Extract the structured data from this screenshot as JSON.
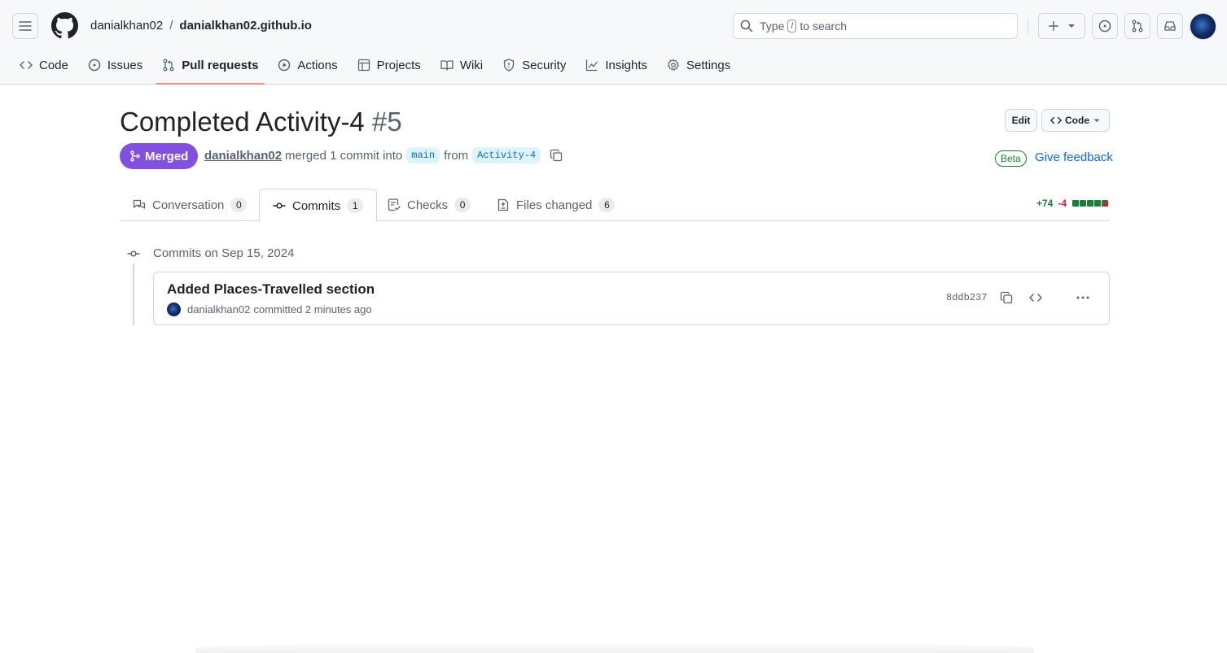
{
  "header": {
    "owner": "danialkhan02",
    "separator": "/",
    "repo": "danialkhan02.github.io",
    "search": {
      "prefix": "Type",
      "key": "/",
      "suffix": "to search"
    }
  },
  "nav": {
    "items": [
      {
        "label": "Code",
        "icon": "code-icon"
      },
      {
        "label": "Issues",
        "icon": "issue-icon"
      },
      {
        "label": "Pull requests",
        "icon": "pull-request-icon",
        "selected": true
      },
      {
        "label": "Actions",
        "icon": "play-icon"
      },
      {
        "label": "Projects",
        "icon": "table-icon"
      },
      {
        "label": "Wiki",
        "icon": "book-icon"
      },
      {
        "label": "Security",
        "icon": "shield-icon"
      },
      {
        "label": "Insights",
        "icon": "graph-icon"
      },
      {
        "label": "Settings",
        "icon": "gear-icon"
      }
    ]
  },
  "pr": {
    "title": "Completed Activity-4",
    "number": "#5",
    "edit_label": "Edit",
    "code_label": "Code",
    "state": "Merged",
    "author": "danialkhan02",
    "merged_text": "merged 1 commit into",
    "base_branch": "main",
    "from_text": "from",
    "head_branch": "Activity-4",
    "beta_label": "Beta",
    "feedback_label": "Give feedback"
  },
  "tabs": [
    {
      "label": "Conversation",
      "count": "0"
    },
    {
      "label": "Commits",
      "count": "1",
      "selected": true
    },
    {
      "label": "Checks",
      "count": "0"
    },
    {
      "label": "Files changed",
      "count": "6"
    }
  ],
  "diffstat": {
    "additions": "+74",
    "deletions": "-4",
    "colors": {
      "add": "#1a7f37",
      "del": "#cf222e"
    }
  },
  "commits": {
    "heading": "Commits on Sep 15, 2024",
    "items": [
      {
        "title": "Added Places-Travelled section",
        "author": "danialkhan02",
        "time_text": "committed 2 minutes ago",
        "sha": "8ddb237"
      }
    ]
  },
  "colors": {
    "merged": "#8250df",
    "link": "#0969da",
    "underline_nav": "#fd8c73"
  }
}
